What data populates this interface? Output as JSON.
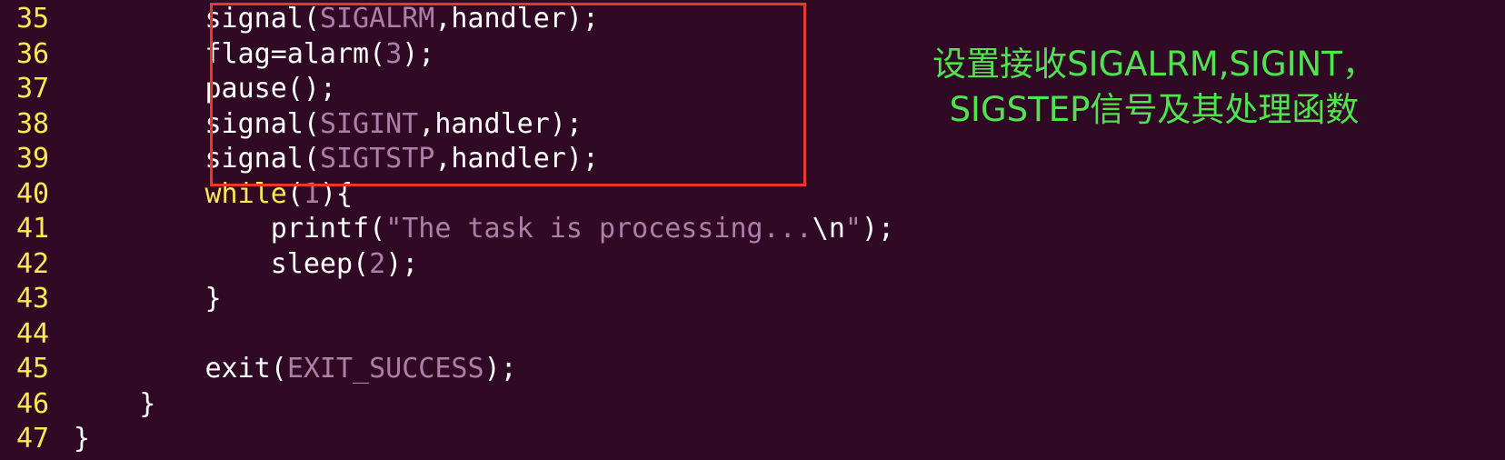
{
  "editor": {
    "lines": [
      {
        "num": "35",
        "indent": "        ",
        "parts": [
          {
            "t": "signal(",
            "c": ""
          },
          {
            "t": "SIGALRM",
            "c": "const"
          },
          {
            "t": ",handler);",
            "c": ""
          }
        ]
      },
      {
        "num": "36",
        "indent": "        ",
        "parts": [
          {
            "t": "flag=alarm(",
            "c": ""
          },
          {
            "t": "3",
            "c": "num"
          },
          {
            "t": ");",
            "c": ""
          }
        ]
      },
      {
        "num": "37",
        "indent": "        ",
        "parts": [
          {
            "t": "pause();",
            "c": ""
          }
        ]
      },
      {
        "num": "38",
        "indent": "        ",
        "parts": [
          {
            "t": "signal(",
            "c": ""
          },
          {
            "t": "SIGINT",
            "c": "const"
          },
          {
            "t": ",handler);",
            "c": ""
          }
        ]
      },
      {
        "num": "39",
        "indent": "        ",
        "parts": [
          {
            "t": "signal(",
            "c": ""
          },
          {
            "t": "SIGTSTP",
            "c": "const"
          },
          {
            "t": ",handler);",
            "c": ""
          }
        ]
      },
      {
        "num": "40",
        "indent": "        ",
        "parts": [
          {
            "t": "while",
            "c": "kw"
          },
          {
            "t": "(",
            "c": ""
          },
          {
            "t": "1",
            "c": "num"
          },
          {
            "t": "){",
            "c": ""
          }
        ]
      },
      {
        "num": "41",
        "indent": "            ",
        "parts": [
          {
            "t": "printf(",
            "c": ""
          },
          {
            "t": "\"The task is processing...",
            "c": "str"
          },
          {
            "t": "\\n",
            "c": ""
          },
          {
            "t": "\"",
            "c": "str"
          },
          {
            "t": ");",
            "c": ""
          }
        ]
      },
      {
        "num": "42",
        "indent": "            ",
        "parts": [
          {
            "t": "sleep(",
            "c": ""
          },
          {
            "t": "2",
            "c": "num"
          },
          {
            "t": ");",
            "c": ""
          }
        ]
      },
      {
        "num": "43",
        "indent": "        ",
        "parts": [
          {
            "t": "}",
            "c": ""
          }
        ]
      },
      {
        "num": "44",
        "indent": "",
        "parts": []
      },
      {
        "num": "45",
        "indent": "        ",
        "parts": [
          {
            "t": "exit(",
            "c": ""
          },
          {
            "t": "EXIT_SUCCESS",
            "c": "const"
          },
          {
            "t": ");",
            "c": ""
          }
        ]
      },
      {
        "num": "46",
        "indent": "    ",
        "parts": [
          {
            "t": "}",
            "c": ""
          }
        ]
      },
      {
        "num": "47",
        "indent": "",
        "parts": [
          {
            "t": "}",
            "c": ""
          }
        ]
      }
    ]
  },
  "annotation": {
    "line1": "设置接收SIGALRM,SIGINT，",
    "line2": "SIGSTEP信号及其处理函数"
  },
  "colors": {
    "background": "#300a24",
    "line_number": "#fce94f",
    "code_text": "#ffffff",
    "literal": "#ad7fa8",
    "highlight_border": "#e8372b",
    "annotation_text": "#4ee44e"
  }
}
